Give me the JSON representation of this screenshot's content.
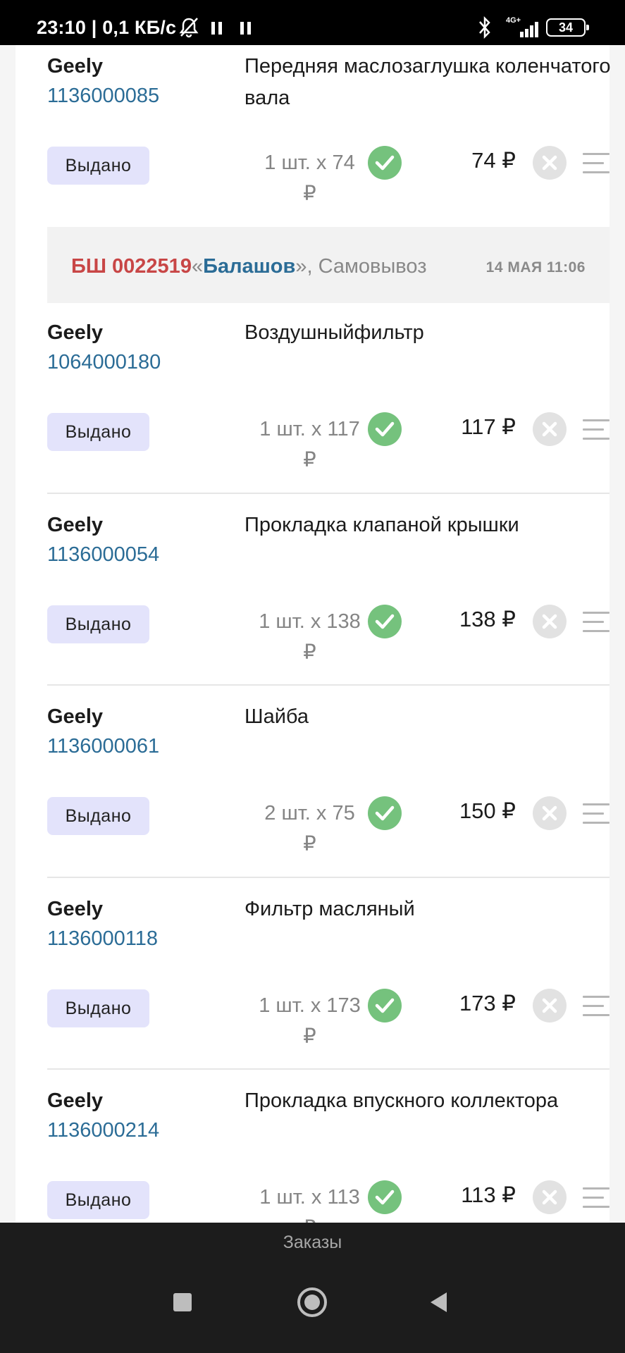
{
  "status_bar": {
    "time_speed": "23:10 | 0,1 КБ/с",
    "network_label": "4G+",
    "battery": "34"
  },
  "order": {
    "number": "БШ 0022519",
    "quote_open": "«",
    "store": "Балашов",
    "quote_close": "»",
    "delivery": ", Самовывоз",
    "date": "14 МАЯ 11:06"
  },
  "items": [
    {
      "brand": "Geely",
      "article": "1136000085",
      "name": "Передняя маслозаглушка коленчатого вала",
      "status": "Выдано",
      "qty_line": "1 шт. x 74",
      "currency": "₽",
      "total": "74 ₽"
    },
    {
      "brand": "Geely",
      "article": "1064000180",
      "name": "Воздушныйфильтр",
      "status": "Выдано",
      "qty_line": "1 шт. x 117",
      "currency": "₽",
      "total": "117 ₽"
    },
    {
      "brand": "Geely",
      "article": "1136000054",
      "name": "Прокладка клапаной крышки",
      "status": "Выдано",
      "qty_line": "1 шт. x 138",
      "currency": "₽",
      "total": "138 ₽"
    },
    {
      "brand": "Geely",
      "article": "1136000061",
      "name": "Шайба",
      "status": "Выдано",
      "qty_line": "2 шт. x 75",
      "currency": "₽",
      "total": "150 ₽"
    },
    {
      "brand": "Geely",
      "article": "1136000118",
      "name": "Фильтр масляный",
      "status": "Выдано",
      "qty_line": "1 шт. x 173",
      "currency": "₽",
      "total": "173 ₽"
    },
    {
      "brand": "Geely",
      "article": "1136000214",
      "name": "Прокладка впускного коллектора",
      "status": "Выдано",
      "qty_line": "1 шт. x 113",
      "currency": "₽",
      "total": "113 ₽"
    }
  ],
  "tab_bar": {
    "label": "Заказы"
  },
  "colors": {
    "status_btn_bg": "#e3e3fb",
    "check_green": "#75c27d",
    "article_blue": "#2b6c96",
    "order_number_red": "#c84646"
  }
}
